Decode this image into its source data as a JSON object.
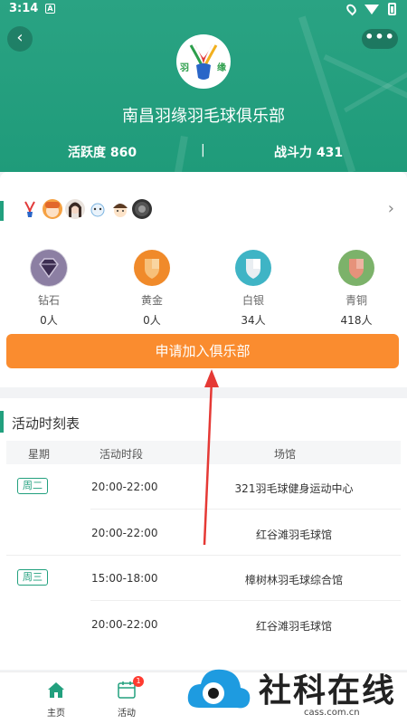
{
  "status_bar": {
    "time": "3:14",
    "a_icon": "A"
  },
  "header": {
    "club_name": "南昌羽缘羽毛球俱乐部",
    "activity": "活跃度 860",
    "separator": "|",
    "power": "战斗力 431",
    "more": "•••",
    "back": "‹",
    "logo_text_left": "羽",
    "logo_text_right": "缘"
  },
  "members": {
    "chevron": "›"
  },
  "tiers": [
    {
      "label": "钻石",
      "count": "0人",
      "color": "#6b5a80"
    },
    {
      "label": "黄金",
      "count": "0人",
      "color": "#f08a2a"
    },
    {
      "label": "白银",
      "count": "34人",
      "color": "#3fb4c5"
    },
    {
      "label": "青铜",
      "count": "418人",
      "color": "#e6927b"
    }
  ],
  "join_label": "申请加入俱乐部",
  "schedule": {
    "title": "活动时刻表",
    "headers": [
      "星期",
      "活动时段",
      "场馆"
    ],
    "rows": [
      {
        "day": "周二",
        "time": "20:00-22:00",
        "venue": "321羽毛球健身运动中心"
      },
      {
        "day": "",
        "time": "20:00-22:00",
        "venue": "红谷滩羽毛球馆"
      },
      {
        "day": "周三",
        "time": "15:00-18:00",
        "venue": "樟树林羽毛球综合馆"
      },
      {
        "day": "",
        "time": "20:00-22:00",
        "venue": "红谷滩羽毛球馆"
      }
    ]
  },
  "tabs": [
    {
      "label": "主页"
    },
    {
      "label": "活动",
      "badge": "1"
    }
  ],
  "watermark": {
    "text": "社科在线",
    "sub": "cass.com.cn"
  },
  "colors": {
    "primary": "#22a07e",
    "accent": "#fa8c2f",
    "badge": "#ff3b30"
  }
}
